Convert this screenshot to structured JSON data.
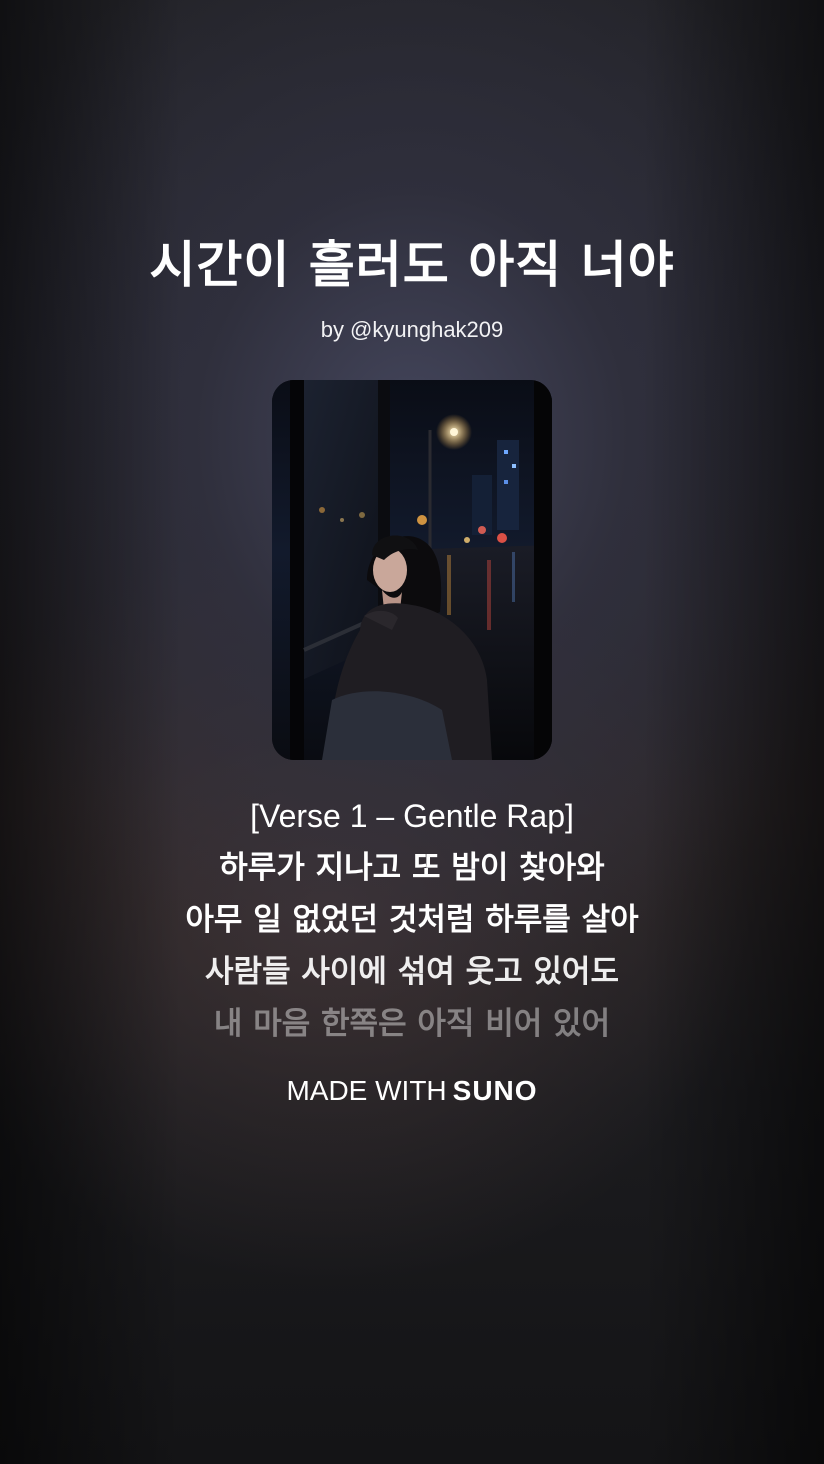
{
  "song": {
    "title": "시간이 흘러도 아직 너야",
    "author": "by @kyunghak209"
  },
  "cover": {
    "icon": "album-cover-rainy-night-bus-stop"
  },
  "lyrics": {
    "section": "[Verse 1 – Gentle Rap]",
    "lines": [
      "하루가 지나고 또 밤이 찾아와",
      "아무 일 없었던 것처럼 하루를 살아",
      "사람들 사이에 섞여 웃고 있어도",
      "내 마음 한쪽은 아직 비어 있어"
    ]
  },
  "footer": {
    "made_with": "MADE WITH",
    "brand": "SUNO"
  },
  "colors": {
    "text": "#ffffff",
    "background": "#2a2a33"
  }
}
